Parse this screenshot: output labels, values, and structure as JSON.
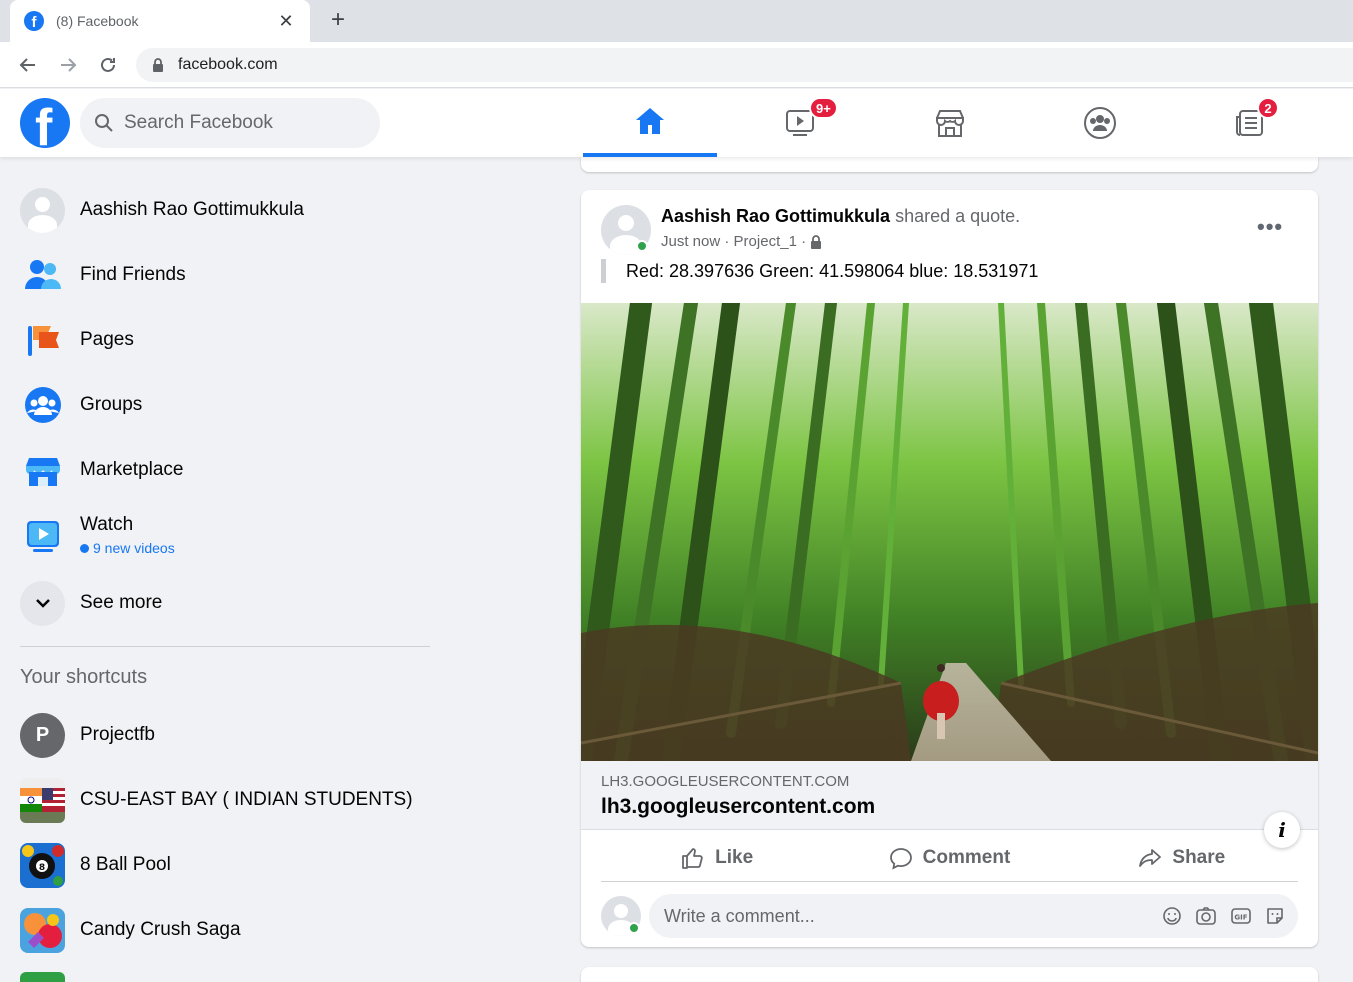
{
  "browser": {
    "tab_title": "(8) Facebook",
    "url": "facebook.com"
  },
  "header": {
    "search_placeholder": "Search Facebook",
    "nav": [
      {
        "name": "home",
        "badge": ""
      },
      {
        "name": "watch",
        "badge": "9+"
      },
      {
        "name": "marketplace",
        "badge": ""
      },
      {
        "name": "groups",
        "badge": ""
      },
      {
        "name": "gaming",
        "badge": "2"
      }
    ]
  },
  "sidebar": {
    "profile_name": "Aashish Rao Gottimukkula",
    "items": [
      {
        "label": "Find Friends"
      },
      {
        "label": "Pages"
      },
      {
        "label": "Groups"
      },
      {
        "label": "Marketplace"
      },
      {
        "label": "Watch",
        "sub": "9 new videos"
      }
    ],
    "see_more": "See more",
    "shortcuts_title": "Your shortcuts",
    "shortcuts": [
      {
        "label": "Projectfb",
        "initial": "P"
      },
      {
        "label": "CSU-EAST BAY ( INDIAN STUDENTS)"
      },
      {
        "label": "8 Ball Pool"
      },
      {
        "label": "Candy Crush Saga"
      }
    ]
  },
  "post": {
    "author": "Aashish Rao Gottimukkula",
    "action": "shared a quote.",
    "time": "Just now",
    "project": "Project_1",
    "quote": "Red: 28.397636 Green: 41.598064 blue: 18.531971",
    "link_domain": "LH3.GOOGLEUSERCONTENT.COM",
    "link_title": "lh3.googleusercontent.com",
    "like": "Like",
    "comment": "Comment",
    "share": "Share",
    "comment_placeholder": "Write a comment..."
  }
}
